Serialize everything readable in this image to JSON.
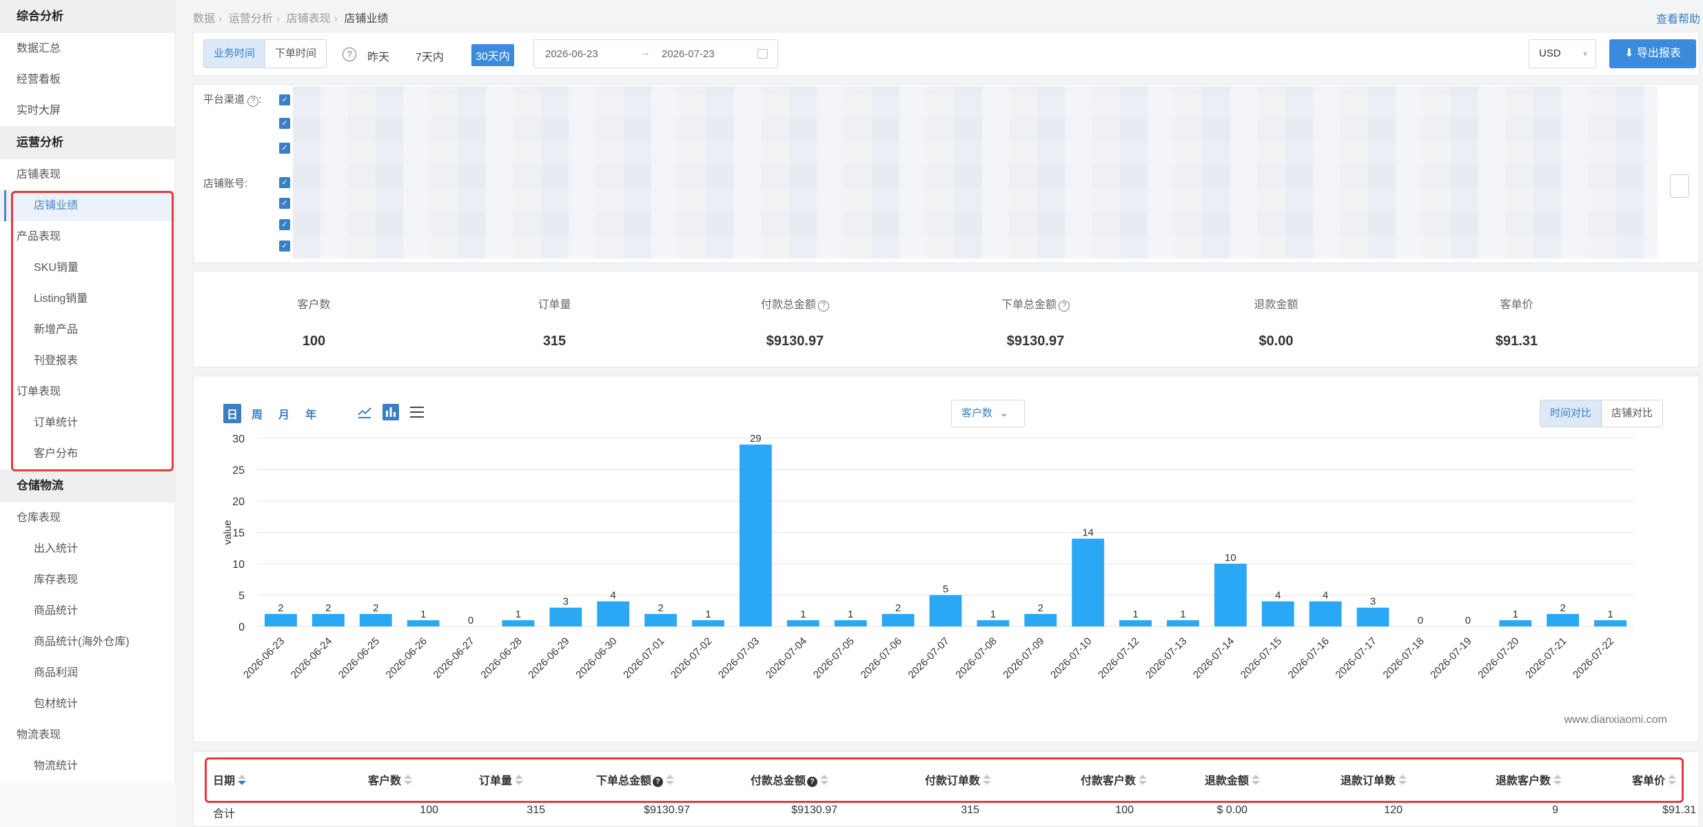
{
  "sidebar": {
    "sections": [
      {
        "title": "综合分析",
        "items": [
          {
            "label": "数据汇总",
            "level": 1
          },
          {
            "label": "经营看板",
            "level": 1
          },
          {
            "label": "实时大屏",
            "level": 1
          }
        ]
      },
      {
        "title": "运营分析",
        "items": [
          {
            "label": "店铺表现",
            "level": 1
          },
          {
            "label": "店铺业绩",
            "level": 2,
            "active": true
          },
          {
            "label": "产品表现",
            "level": 1
          },
          {
            "label": "SKU销量",
            "level": 2
          },
          {
            "label": "Listing销量",
            "level": 2
          },
          {
            "label": "新增产品",
            "level": 2
          },
          {
            "label": "刊登报表",
            "level": 2
          },
          {
            "label": "订单表现",
            "level": 1
          },
          {
            "label": "订单统计",
            "level": 2
          },
          {
            "label": "客户分布",
            "level": 2
          }
        ]
      },
      {
        "title": "仓储物流",
        "items": [
          {
            "label": "仓库表现",
            "level": 1
          },
          {
            "label": "出入统计",
            "level": 2
          },
          {
            "label": "库存表现",
            "level": 2
          },
          {
            "label": "商品统计",
            "level": 2
          },
          {
            "label": "商品统计(海外仓库)",
            "level": 2
          },
          {
            "label": "商品利润",
            "level": 2
          },
          {
            "label": "包材统计",
            "level": 2
          },
          {
            "label": "物流表现",
            "level": 1
          },
          {
            "label": "物流统计",
            "level": 2
          }
        ]
      }
    ]
  },
  "breadcrumb": [
    "数据",
    "运营分析",
    "店铺表现",
    "店铺业绩"
  ],
  "help_link": "查看帮助",
  "filters": {
    "time_mode": [
      "业务时间",
      "下单时间"
    ],
    "quick_ranges": [
      "昨天",
      "7天内",
      "30天内"
    ],
    "date_start": "2026-06-23",
    "date_end": "2026-07-23",
    "currency": "USD",
    "export_label": "导出报表",
    "platform_label": "平台渠道",
    "store_label": "店铺账号:"
  },
  "kpis": [
    {
      "label": "客户数",
      "value": "100",
      "help": false
    },
    {
      "label": "订单量",
      "value": "315",
      "help": false
    },
    {
      "label": "付款总金额",
      "value": "$9130.97",
      "help": true
    },
    {
      "label": "下单总金额",
      "value": "$9130.97",
      "help": true
    },
    {
      "label": "退款金额",
      "value": "$0.00",
      "help": false
    },
    {
      "label": "客单价",
      "value": "$91.31",
      "help": false
    }
  ],
  "chart_controls": {
    "periods": [
      "日",
      "周",
      "月",
      "年"
    ],
    "metric": "客户数",
    "compare": [
      "时间对比",
      "店铺对比"
    ],
    "watermark": "www.dianxiaomi.com"
  },
  "chart_data": {
    "type": "bar",
    "ylabel": "value",
    "ylim": [
      0,
      30
    ],
    "yticks": [
      0,
      5,
      10,
      15,
      20,
      25,
      30
    ],
    "categories": [
      "2026-06-23",
      "2026-06-24",
      "2026-06-25",
      "2026-06-26",
      "2026-06-27",
      "2026-06-28",
      "2026-06-29",
      "2026-06-30",
      "2026-07-01",
      "2026-07-02",
      "2026-07-03",
      "2026-07-04",
      "2026-07-05",
      "2026-07-06",
      "2026-07-07",
      "2026-07-08",
      "2026-07-09",
      "2026-07-10",
      "2026-07-12",
      "2026-07-13",
      "2026-07-14",
      "2026-07-15",
      "2026-07-16",
      "2026-07-17",
      "2026-07-18",
      "2026-07-19",
      "2026-07-20",
      "2026-07-21",
      "2026-07-22"
    ],
    "values": [
      2,
      2,
      2,
      1,
      0,
      1,
      3,
      4,
      2,
      1,
      29,
      1,
      1,
      2,
      5,
      1,
      2,
      14,
      1,
      1,
      10,
      4,
      4,
      3,
      0,
      0,
      1,
      2,
      1
    ],
    "color": "#2aa7f5",
    "grid": true
  },
  "table": {
    "headers": [
      {
        "label": "日期",
        "help": false
      },
      {
        "label": "客户数",
        "help": false
      },
      {
        "label": "订单量",
        "help": false
      },
      {
        "label": "下单总金额",
        "help": true
      },
      {
        "label": "付款总金额",
        "help": true
      },
      {
        "label": "付款订单数",
        "help": false
      },
      {
        "label": "付款客户数",
        "help": false
      },
      {
        "label": "退款金额",
        "help": false
      },
      {
        "label": "退款订单数",
        "help": false
      },
      {
        "label": "退款客户数",
        "help": false
      },
      {
        "label": "客单价",
        "help": false
      }
    ],
    "total_row": [
      "合计",
      "100",
      "315",
      "$9130.97",
      "$9130.97",
      "315",
      "100",
      "$ 0.00",
      "120",
      "9",
      "$91.31"
    ]
  },
  "colors": {
    "accent": "#3a7fc4",
    "bar": "#2aa7f5",
    "highlight": "#e23b3b"
  }
}
